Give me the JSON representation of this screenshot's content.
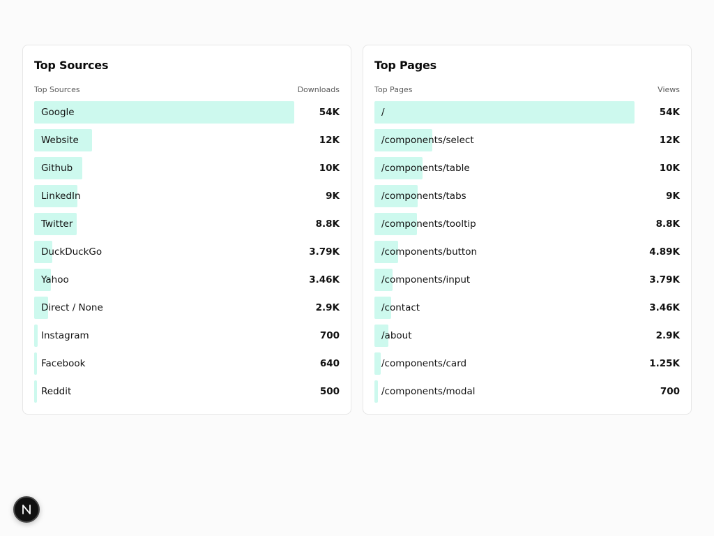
{
  "bar_color": "#cdf9ee",
  "chart_data": [
    {
      "type": "bar",
      "orientation": "horizontal",
      "title": "Top Sources",
      "label_header": "Top Sources",
      "value_header": "Downloads",
      "categories": [
        "Google",
        "Website",
        "Github",
        "LinkedIn",
        "Twitter",
        "DuckDuckGo",
        "Yahoo",
        "Direct / None",
        "Instagram",
        "Facebook",
        "Reddit"
      ],
      "values": [
        54000,
        12000,
        10000,
        9000,
        8800,
        3790,
        3460,
        2900,
        700,
        640,
        500
      ],
      "value_labels": [
        "54K",
        "12K",
        "10K",
        "9K",
        "8.8K",
        "3.79K",
        "3.46K",
        "2.9K",
        "700",
        "640",
        "500"
      ]
    },
    {
      "type": "bar",
      "orientation": "horizontal",
      "title": "Top Pages",
      "label_header": "Top Pages",
      "value_header": "Views",
      "categories": [
        "/",
        "/components/select",
        "/components/table",
        "/components/tabs",
        "/components/tooltip",
        "/components/button",
        "/components/input",
        "/contact",
        "/about",
        "/components/card",
        "/components/modal"
      ],
      "values": [
        54000,
        12000,
        10000,
        9000,
        8800,
        4890,
        3790,
        3460,
        2900,
        1250,
        700
      ],
      "value_labels": [
        "54K",
        "12K",
        "10K",
        "9K",
        "8.8K",
        "4.89K",
        "3.79K",
        "3.46K",
        "2.9K",
        "1.25K",
        "700"
      ]
    }
  ],
  "badge": {
    "letter": "N",
    "icon": "nextjs-logo-icon"
  }
}
